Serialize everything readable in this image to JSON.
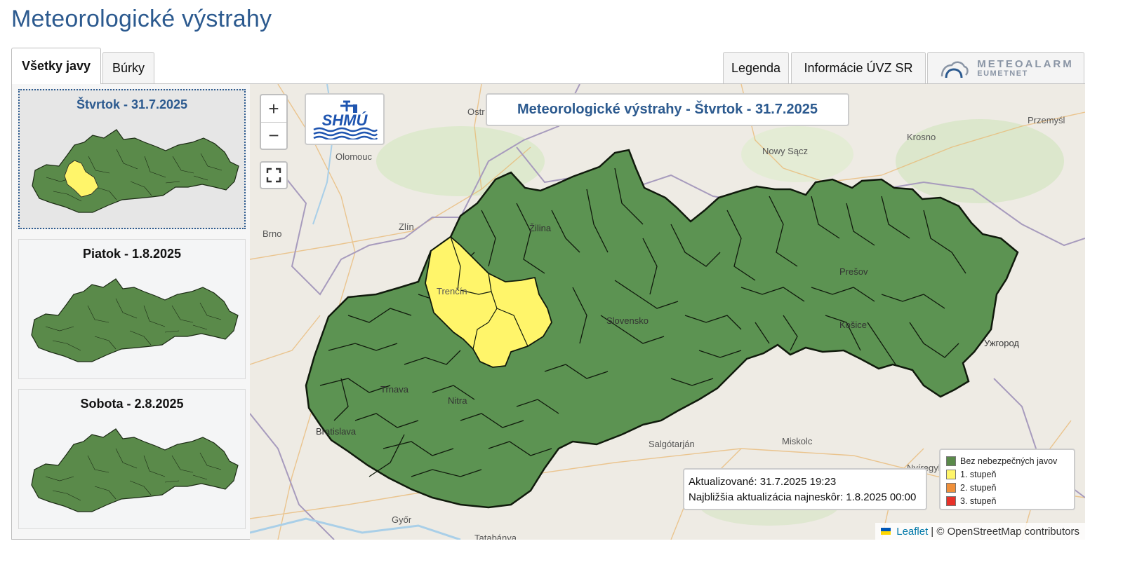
{
  "page": {
    "title": "Meteorologické výstrahy"
  },
  "tabs": {
    "all": "Všetky javy",
    "storms": "Búrky",
    "legend": "Legenda",
    "uvz": "Informácie ÚVZ SR",
    "meteoalarm_title": "METEOALARM",
    "meteoalarm_sub": "EUMETNET"
  },
  "days": [
    {
      "label": "Štvrtok - 31.7.2025",
      "selected": true,
      "has_yellow": true
    },
    {
      "label": "Piatok - 1.8.2025",
      "selected": false,
      "has_yellow": false
    },
    {
      "label": "Sobota - 2.8.2025",
      "selected": false,
      "has_yellow": false
    }
  ],
  "map": {
    "title": "Meteorologické výstrahy - Štvrtok - 31.7.2025",
    "logo_text": "SHMÚ",
    "zoom_in": "+",
    "zoom_out": "−",
    "cities": {
      "ostrava": "Ostr",
      "olomouc": "Olomouc",
      "nowy_sacz": "Nowy Sącz",
      "krosno": "Krosno",
      "przemysl": "Przemyśl",
      "brno": "Brno",
      "zlin": "Zlín",
      "zilina": "Žilina",
      "trencin": "Trenčín",
      "presov": "Prešov",
      "slovensko": "Slovensko",
      "kosice": "Košice",
      "uzhorod": "Ужгород",
      "trnava": "Trnava",
      "nitra": "Nitra",
      "bratislava": "Bratislava",
      "salgotarjan": "Salgótarján",
      "miskolc": "Miskolc",
      "nyiregyhaza": "Nyíregyháza",
      "gyor": "Győr",
      "tatabanya": "Tatabánya"
    }
  },
  "legend": {
    "items": [
      {
        "label": "Bez nebezpečných javov",
        "color": "#5a8a4a"
      },
      {
        "label": "1. stupeň",
        "color": "#fff56a"
      },
      {
        "label": "2. stupeň",
        "color": "#f0903a"
      },
      {
        "label": "3. stupeň",
        "color": "#e8322a"
      }
    ]
  },
  "update": {
    "updated": "Aktualizované: 31.7.2025 19:23",
    "next": "Najbližšia aktualizácia najneskôr: 1.8.2025 00:00"
  },
  "attribution": {
    "leaflet": "Leaflet",
    "osm": "| © OpenStreetMap contributors"
  },
  "colors": {
    "accent": "#2c5a8f",
    "green": "#5a8a4a",
    "green_map": "#5c9352",
    "yellow": "#fff56a"
  }
}
